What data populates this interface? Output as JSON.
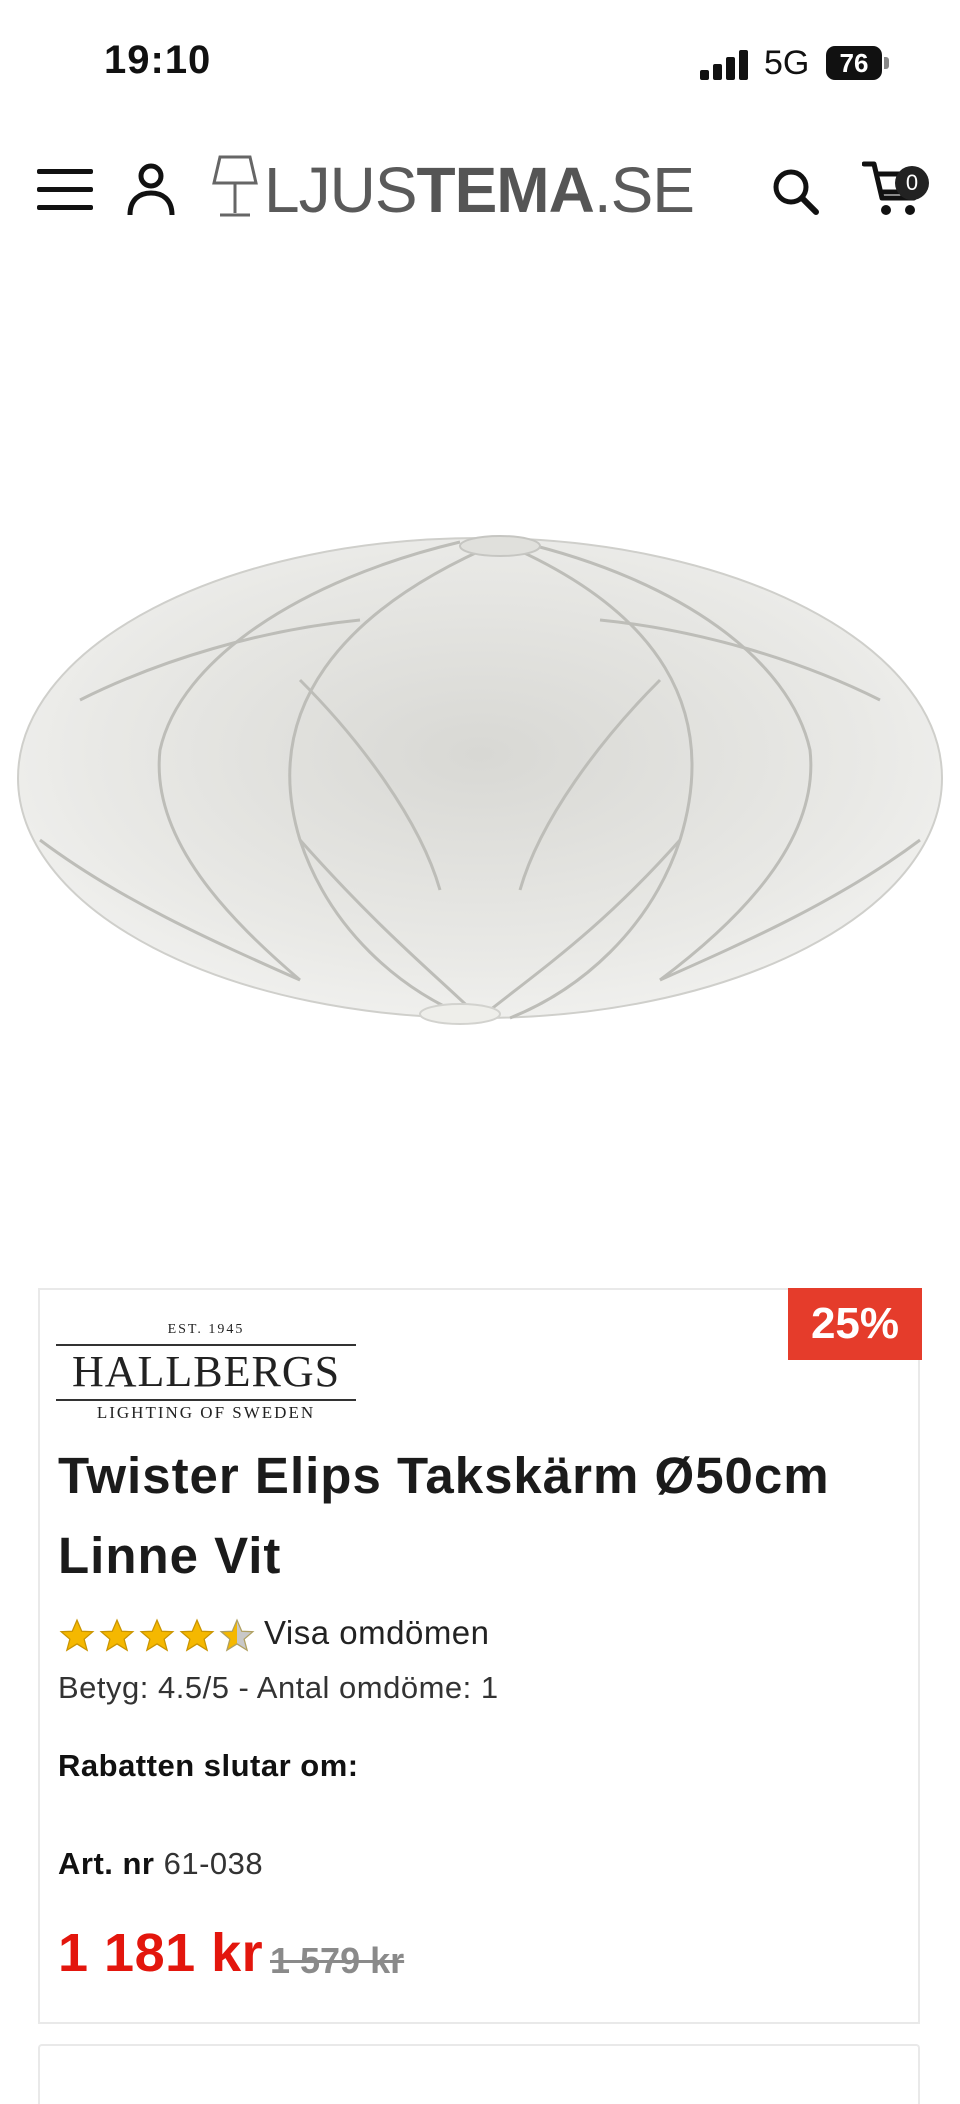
{
  "status_bar": {
    "time": "19:10",
    "network": "5G",
    "battery": "76"
  },
  "header": {
    "menu_icon": "hamburger-icon",
    "account_icon": "user-icon",
    "logo": {
      "part1": "LJUS",
      "part2": "TEMA",
      "part3": ".SE"
    },
    "search_icon": "search-icon",
    "cart_icon": "cart-icon",
    "cart_count": "0"
  },
  "product": {
    "discount_badge": "25%",
    "brand": {
      "est": "EST. 1945",
      "name": "HALLBERGS",
      "tagline": "LIGHTING OF SWEDEN"
    },
    "title": "Twister Elips Takskärm Ø50cm Linne Vit",
    "rating_stars": 4.5,
    "reviews_link": "Visa omdömen",
    "rating_text": "Betyg: 4.5/5 - Antal omdöme: 1",
    "countdown_label": "Rabatten slutar om:",
    "art_label": "Art. nr",
    "art_number": "61-038",
    "price": "1 181 kr",
    "old_price": "1 579 kr"
  },
  "colors": {
    "accent": "#e53c2b",
    "price": "#e3160d",
    "star": "#f5b800"
  }
}
